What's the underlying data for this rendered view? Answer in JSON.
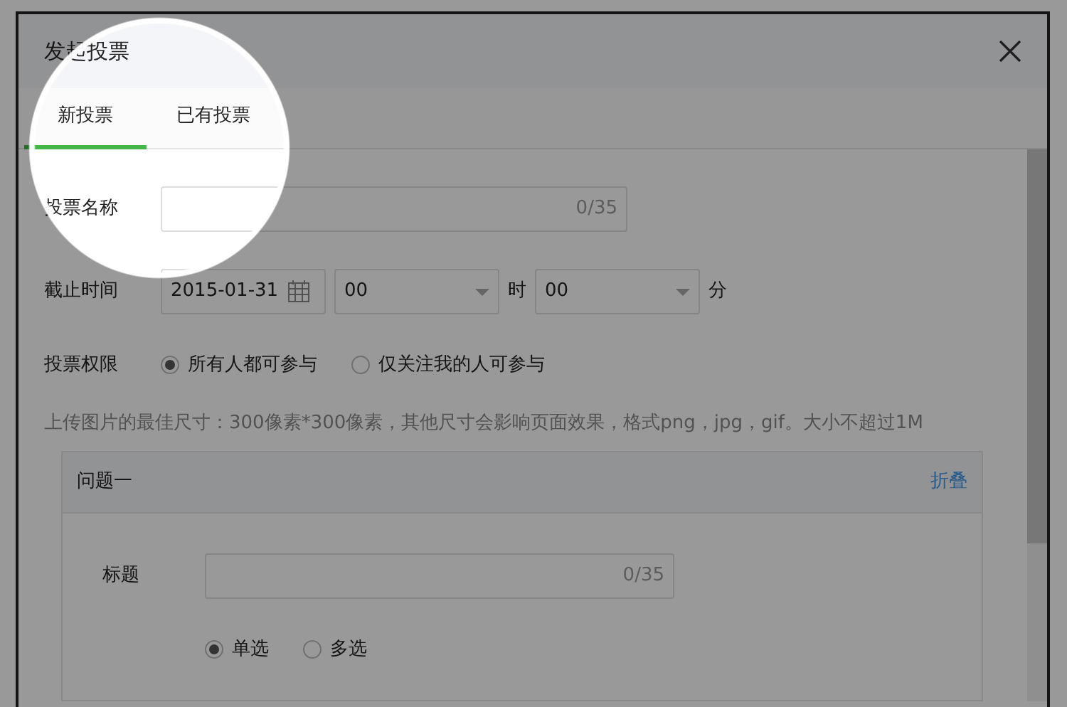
{
  "dialog": {
    "title": "发起投票"
  },
  "tabs": [
    {
      "label": "新投票",
      "selected": true
    },
    {
      "label": "已有投票",
      "selected": false
    }
  ],
  "form": {
    "name": {
      "label": "投票名称",
      "counter": "0/35"
    },
    "deadline": {
      "label": "截止时间",
      "date": "2015-01-31",
      "hour": "00",
      "hour_unit": "时",
      "minute": "00",
      "minute_unit": "分"
    },
    "permission": {
      "label": "投票权限",
      "options": [
        {
          "label": "所有人都可参与",
          "selected": true
        },
        {
          "label": "仅关注我的人可参与",
          "selected": false
        }
      ]
    },
    "upload_hint": "上传图片的最佳尺寸：300像素*300像素，其他尺寸会影响页面效果，格式png，jpg，gif。大小不超过1M"
  },
  "question": {
    "title": "问题一",
    "collapse": "折叠",
    "field_label": "标题",
    "counter": "0/35",
    "types": [
      {
        "label": "单选",
        "selected": true
      },
      {
        "label": "多选",
        "selected": false
      }
    ]
  }
}
